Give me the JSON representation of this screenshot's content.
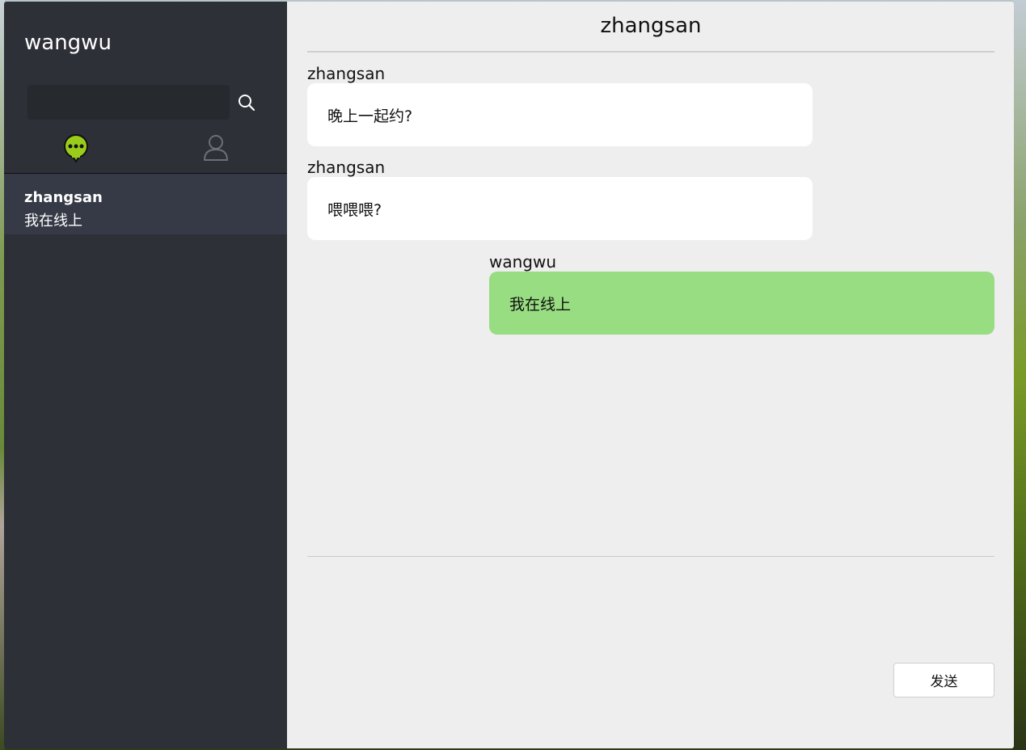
{
  "app": {
    "current_user": "wangwu"
  },
  "sidebar": {
    "search": {
      "value": "",
      "placeholder": ""
    },
    "tabs": [
      {
        "name": "chat-tab",
        "icon": "chat-bubble-icon",
        "active": true,
        "color": "#9acd1a"
      },
      {
        "name": "contacts-tab",
        "icon": "user-icon",
        "active": false,
        "color": "#6c6f78"
      }
    ],
    "contacts": [
      {
        "name": "zhangsan",
        "last_message": "我在线上",
        "selected": true
      }
    ]
  },
  "chat": {
    "title": "zhangsan",
    "messages": [
      {
        "sender": "zhangsan",
        "text": "晚上一起约?",
        "direction": "in"
      },
      {
        "sender": "zhangsan",
        "text": "喂喂喂?",
        "direction": "in"
      },
      {
        "sender": "wangwu",
        "text": "我在线上",
        "direction": "out"
      }
    ],
    "compose": {
      "value": "",
      "send_label": "发送"
    }
  },
  "colors": {
    "sidebar_bg": "#2e3038",
    "selected_contact_bg": "#353a46",
    "main_bg": "#eeeeee",
    "incoming_bubble": "#ffffff",
    "outgoing_bubble": "#98dd82",
    "active_tab": "#9acd1a"
  }
}
